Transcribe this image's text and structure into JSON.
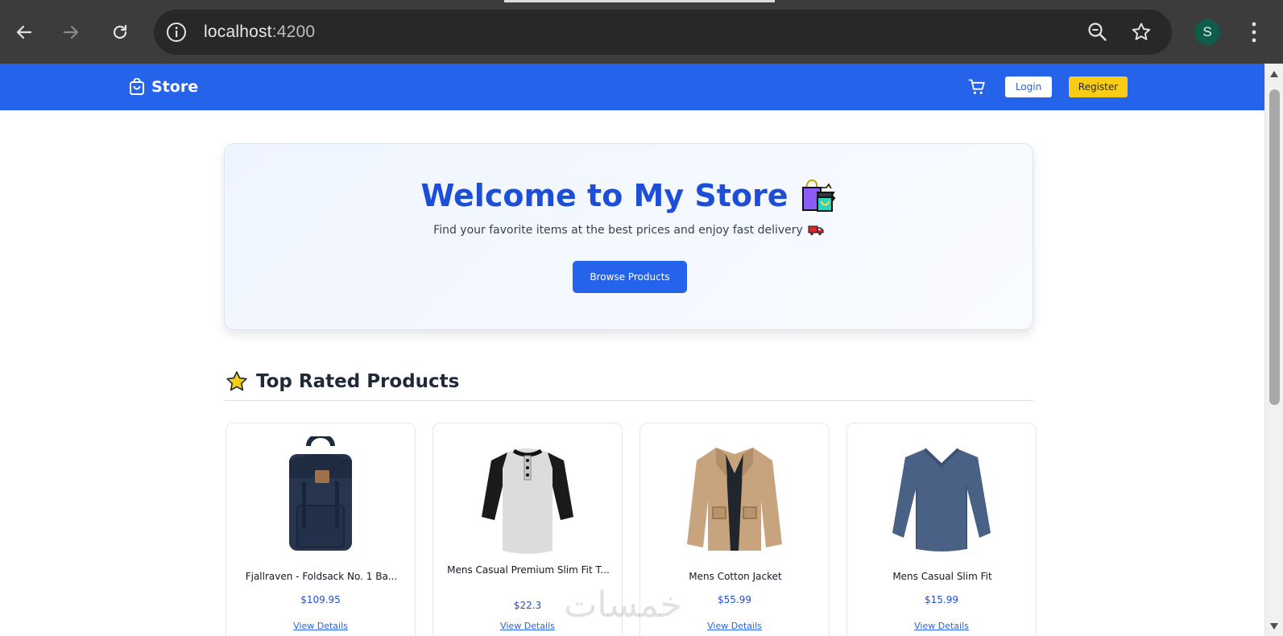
{
  "browser": {
    "url_host": "localhost",
    "url_port": ":4200",
    "profile_initial": "S"
  },
  "header": {
    "brand": "Store",
    "login_label": "Login",
    "register_label": "Register",
    "accent_color": "#2563eb",
    "register_color": "#facc15"
  },
  "hero": {
    "title": "Welcome to My Store",
    "subtitle": "Find your favorite items at the best prices and enjoy fast delivery",
    "button_label": "Browse Products"
  },
  "section": {
    "title": "Top Rated Products"
  },
  "products": [
    {
      "title": "Fjallraven - Foldsack No. 1 Ba...",
      "price": "$109.95",
      "link": "View Details",
      "image": "backpack"
    },
    {
      "title": "Mens Casual Premium Slim Fit T...",
      "price": "$22.3",
      "link": "View Details",
      "image": "henley-shirt"
    },
    {
      "title": "Mens Cotton Jacket",
      "price": "$55.99",
      "link": "View Details",
      "image": "cotton-jacket"
    },
    {
      "title": "Mens Casual Slim Fit",
      "price": "$15.99",
      "link": "View Details",
      "image": "slim-fit-tee"
    }
  ],
  "watermark": "خمسات"
}
